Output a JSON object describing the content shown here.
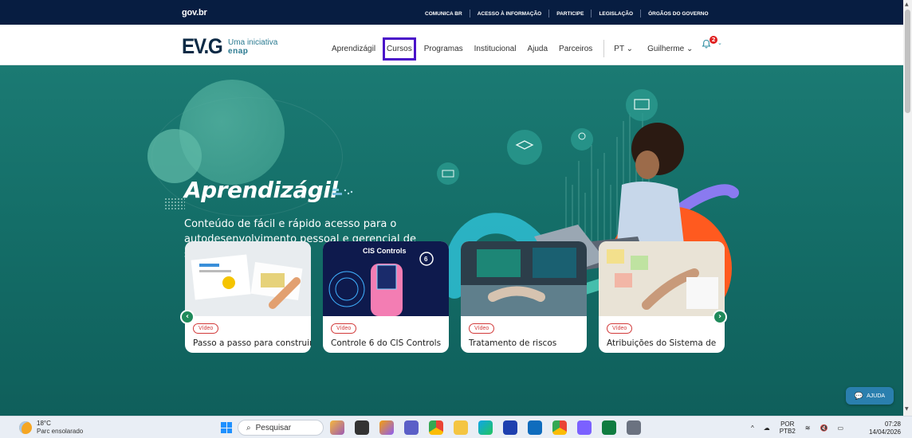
{
  "govbar": {
    "logo": "gov.br",
    "links": [
      "COMUNICA BR",
      "ACESSO À INFORMAÇÃO",
      "PARTICIPE",
      "LEGISLAÇÃO",
      "ÓRGÃOS DO GOVERNO"
    ]
  },
  "header": {
    "brand": "EV.G",
    "tagline_1": "Uma iniciativa",
    "tagline_2": "enap",
    "nav": [
      "Aprendizágil",
      "Cursos",
      "Programas",
      "Institucional",
      "Ajuda",
      "Parceiros"
    ],
    "active_nav": "Cursos",
    "language": "PT",
    "user": "Guilherme",
    "notification_count": "2"
  },
  "hero": {
    "title": "Aprendizágil",
    "description": "Conteúdo de fácil e rápido acesso para o autodesenvolvimento pessoal e gerencial de servidores e cidadãos."
  },
  "cards": [
    {
      "badge": "Vídeo",
      "title": "Passo a passo para construir"
    },
    {
      "badge": "Vídeo",
      "title": "Controle 6 do CIS Controls",
      "thumb_text": "CIS Controls",
      "thumb_num": "6"
    },
    {
      "badge": "Vídeo",
      "title": "Tratamento de riscos"
    },
    {
      "badge": "Vídeo",
      "title": "Atribuições do Sistema de"
    }
  ],
  "help_button": "AJUDA",
  "taskbar": {
    "weather_temp": "18°C",
    "weather_cond": "Parc ensolarado",
    "search_placeholder": "Pesquisar",
    "lang_1": "POR",
    "lang_2": "PTB2",
    "time": "07:28",
    "date": "14/04/2026"
  },
  "colors": {
    "govbar": "#071d41",
    "hero": "#146e68",
    "active_outline": "#4a12c9",
    "notification": "#e02020",
    "video_badge": "#d23a3a"
  }
}
